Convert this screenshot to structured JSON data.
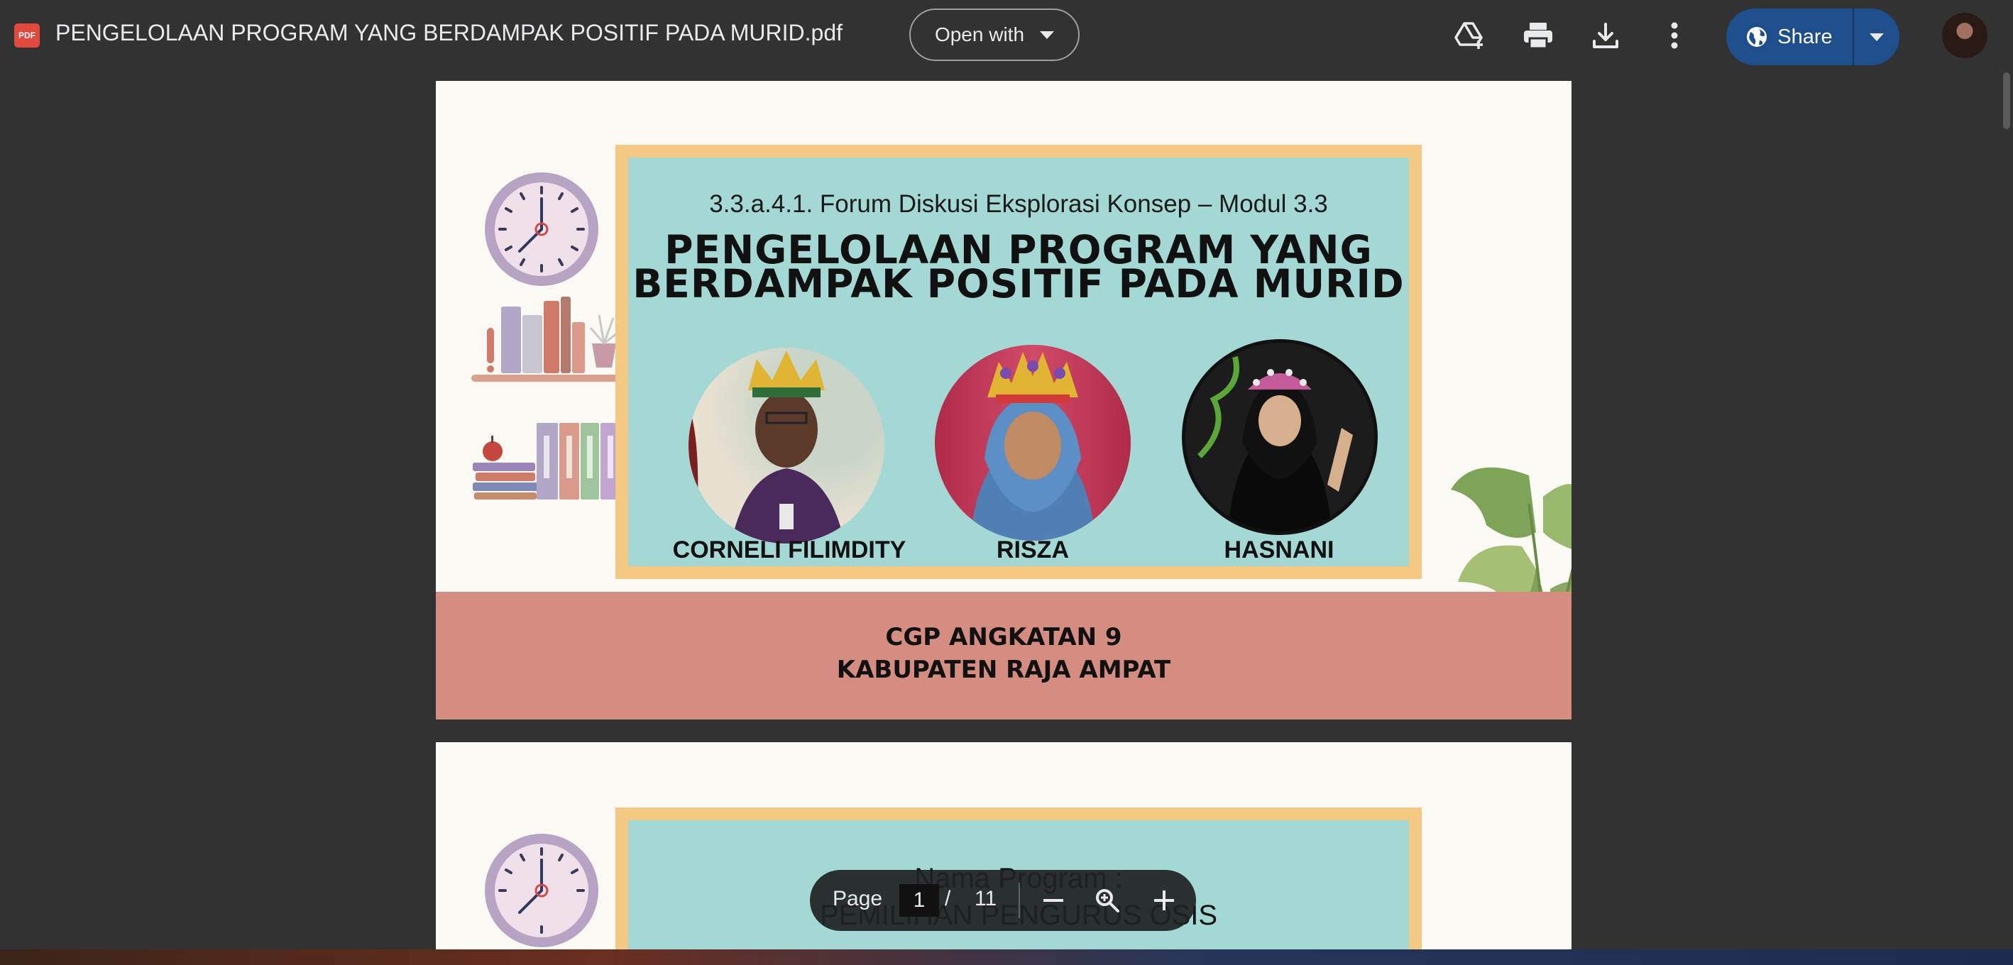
{
  "header": {
    "file_badge": "PDF",
    "title": "PENGELOLAAN PROGRAM YANG BERDAMPAK POSITIF PADA MURID.pdf",
    "open_with_label": "Open with",
    "share_label": "Share",
    "icons": [
      "add-to-drive-icon",
      "print-icon",
      "download-icon",
      "more-vert-icon",
      "globe-icon",
      "dropdown-arrow-icon"
    ]
  },
  "slide1": {
    "subtitle": "3.3.a.4.1. Forum Diskusi Eksplorasi Konsep – Modul 3.3",
    "title_line1": "PENGELOLAAN PROGRAM YANG",
    "title_line2": "BERDAMPAK POSITIF PADA MURID",
    "people": [
      {
        "name": "CORNELI FILIMDITY"
      },
      {
        "name": "RISZA"
      },
      {
        "name": "HASNANI"
      }
    ],
    "footer_line1": "CGP ANGKATAN 9",
    "footer_line2": "KABUPATEN RAJA AMPAT",
    "colors": {
      "background": "#fbf9f3",
      "frame": "#f3c984",
      "panel": "#a4d8d5",
      "band": "#d48d80"
    }
  },
  "slide2": {
    "label": "Nama Program :",
    "value": "PEMILIHAN PENGURUS OSIS"
  },
  "pager": {
    "page_label": "Page",
    "current_page": "1",
    "separator": "/",
    "total_pages": "11",
    "icons": [
      "zoom-out-icon",
      "zoom-icon",
      "zoom-in-icon"
    ]
  }
}
